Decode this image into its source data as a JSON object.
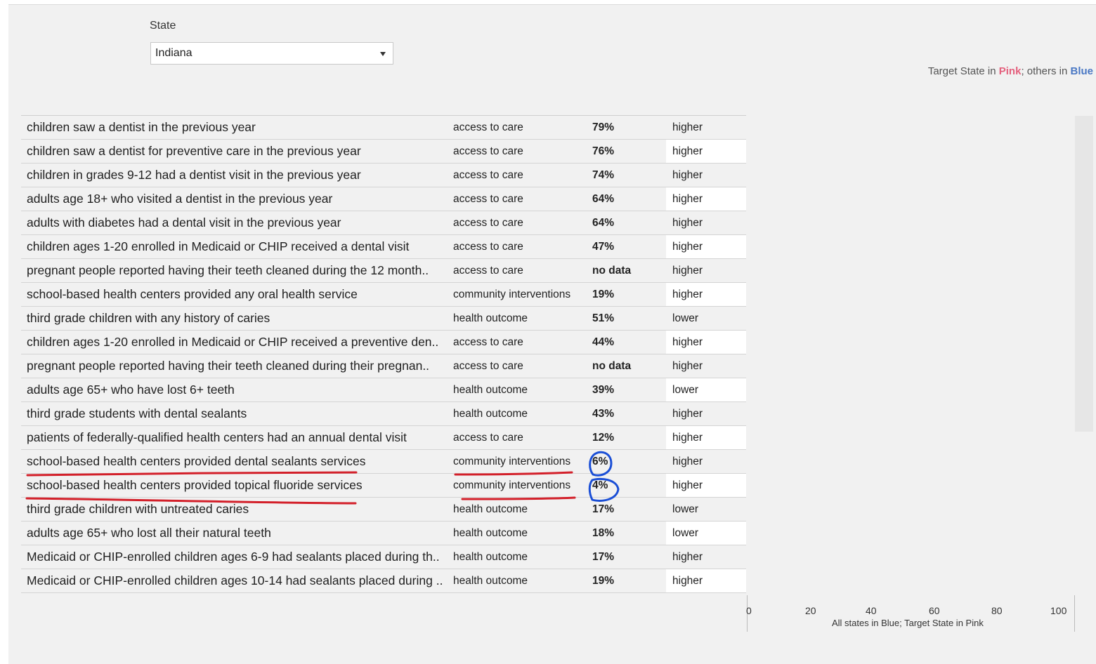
{
  "filter": {
    "label": "State",
    "selected": "Indiana"
  },
  "legend": {
    "prefix": "Target State in ",
    "pink_word": "Pink",
    "middle": "; others in ",
    "blue_word": "Blue",
    "pink_color": "#e4607d",
    "blue_color": "#4a78c4"
  },
  "table": {
    "rows": [
      {
        "measure": "children saw a dentist in the previous year",
        "category": "access to care",
        "value": "79%",
        "direction": "higher"
      },
      {
        "measure": "children saw a dentist for preventive care in the previous year",
        "category": "access to care",
        "value": "76%",
        "direction": "higher"
      },
      {
        "measure": "children in grades 9-12 had a dentist visit in the previous year",
        "category": "access to care",
        "value": "74%",
        "direction": "higher"
      },
      {
        "measure": "adults age 18+ who visited a dentist in the previous year",
        "category": "access to care",
        "value": "64%",
        "direction": "higher"
      },
      {
        "measure": "adults with diabetes had a dental visit in the previous year",
        "category": "access to care",
        "value": "64%",
        "direction": "higher"
      },
      {
        "measure": "children ages 1-20 enrolled in Medicaid or CHIP received a dental visit",
        "category": "access to care",
        "value": "47%",
        "direction": "higher"
      },
      {
        "measure": "pregnant people reported having their teeth cleaned during the 12 month..",
        "category": "access to care",
        "value": "no data",
        "direction": "higher"
      },
      {
        "measure": "school-based health centers provided any oral health service",
        "category": "community interventions",
        "value": "19%",
        "direction": "higher"
      },
      {
        "measure": "third grade children with any history of caries",
        "category": "health outcome",
        "value": "51%",
        "direction": "lower"
      },
      {
        "measure": "children ages 1-20 enrolled in Medicaid or CHIP received a preventive den..",
        "category": "access to care",
        "value": "44%",
        "direction": "higher"
      },
      {
        "measure": "pregnant people reported having their teeth cleaned during their pregnan..",
        "category": "access to care",
        "value": "no data",
        "direction": "higher"
      },
      {
        "measure": "adults age 65+ who have lost 6+ teeth",
        "category": "health outcome",
        "value": "39%",
        "direction": "lower"
      },
      {
        "measure": "third grade students with dental sealants",
        "category": "health outcome",
        "value": "43%",
        "direction": "higher"
      },
      {
        "measure": "patients of federally-qualified health centers had an annual dental visit",
        "category": "access to care",
        "value": "12%",
        "direction": "higher"
      },
      {
        "measure": "school-based health centers provided dental sealants services",
        "category": "community interventions",
        "value": "6%",
        "direction": "higher"
      },
      {
        "measure": "school-based health centers provided topical fluoride services",
        "category": "community interventions",
        "value": "4%",
        "direction": "higher"
      },
      {
        "measure": "third grade children with untreated caries",
        "category": "health outcome",
        "value": "17%",
        "direction": "lower"
      },
      {
        "measure": "adults age 65+ who lost all their natural teeth",
        "category": "health outcome",
        "value": "18%",
        "direction": "lower"
      },
      {
        "measure": "Medicaid or CHIP-enrolled children ages 6-9 had sealants placed during th..",
        "category": "health outcome",
        "value": "17%",
        "direction": "higher"
      },
      {
        "measure": "Medicaid or CHIP-enrolled children ages 10-14 had sealants placed during ..",
        "category": "health outcome",
        "value": "19%",
        "direction": "higher"
      }
    ]
  },
  "axis": {
    "ticks": [
      "0",
      "20",
      "40",
      "60",
      "80",
      "100"
    ],
    "title": "All states in Blue; Target State in Pink"
  },
  "annotations": {
    "underline_color": "#d3202a",
    "circle_color": "#1b4fd6"
  }
}
